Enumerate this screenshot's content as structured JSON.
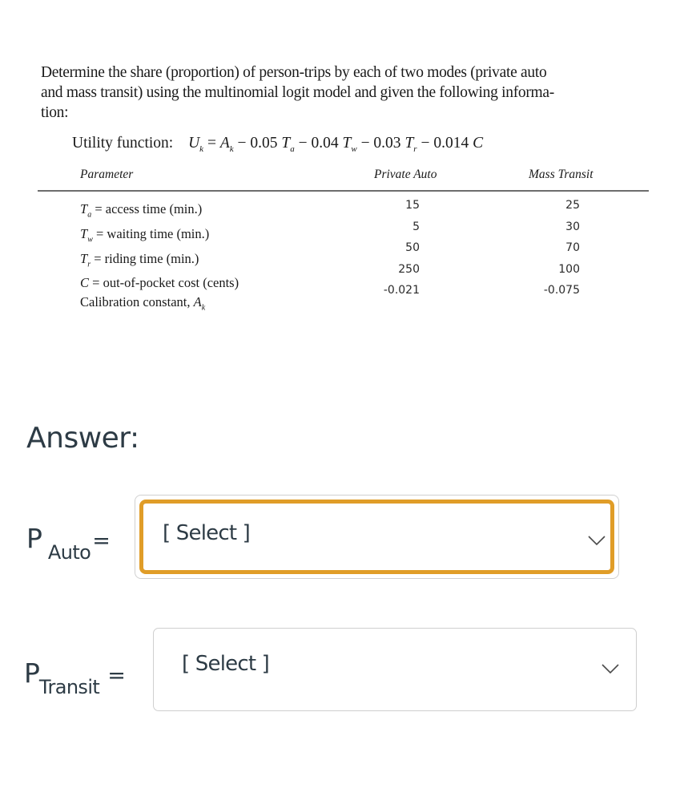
{
  "problem": {
    "text": "Determine the share (proportion) of person-trips by each of two modes (private auto and mass transit) using the multinomial logit model and given the following information:",
    "line1": "Determine the share (proportion) of person-trips by each of two modes (private auto",
    "line2": "and mass transit) using the multinomial logit model and given the following informa-",
    "line3": "tion:"
  },
  "utility": {
    "label": "Utility function:",
    "formula": "U_k = A_k − 0.05 T_a − 0.04 T_w − 0.03 T_r − 0.014 C"
  },
  "table": {
    "headers": {
      "parameter": "Parameter",
      "auto": "Private Auto",
      "transit": "Mass Transit"
    },
    "rows": [
      {
        "symbol": "T",
        "sub": "a",
        "desc": " = access time (min.)",
        "auto": "15",
        "transit": "25"
      },
      {
        "symbol": "T",
        "sub": "w",
        "desc": " = waiting time (min.)",
        "auto": "5",
        "transit": "30"
      },
      {
        "symbol": "T",
        "sub": "r",
        "desc": " = riding time (min.)",
        "auto": "50",
        "transit": "70"
      },
      {
        "symbol": "C",
        "sub": "",
        "desc": " = out-of-pocket cost (cents)",
        "auto": "250",
        "transit": "100"
      },
      {
        "symbol": "",
        "sub": "",
        "desc": "Calibration constant, ",
        "auto": "-0.021",
        "transit": "-0.075"
      }
    ],
    "calib_symbol": "A",
    "calib_sub": "k"
  },
  "answer": {
    "label": "Answer:",
    "auto": {
      "p": "P",
      "sub": "Auto",
      "eq": "=",
      "select_value": "[ Select ]",
      "focused": true
    },
    "transit": {
      "p": "P",
      "sub": "Transit",
      "eq": "=",
      "select_value": "[ Select ]",
      "focused": false
    }
  },
  "colors": {
    "focus_ring": "#e09d28",
    "text": "#2d3b45"
  }
}
